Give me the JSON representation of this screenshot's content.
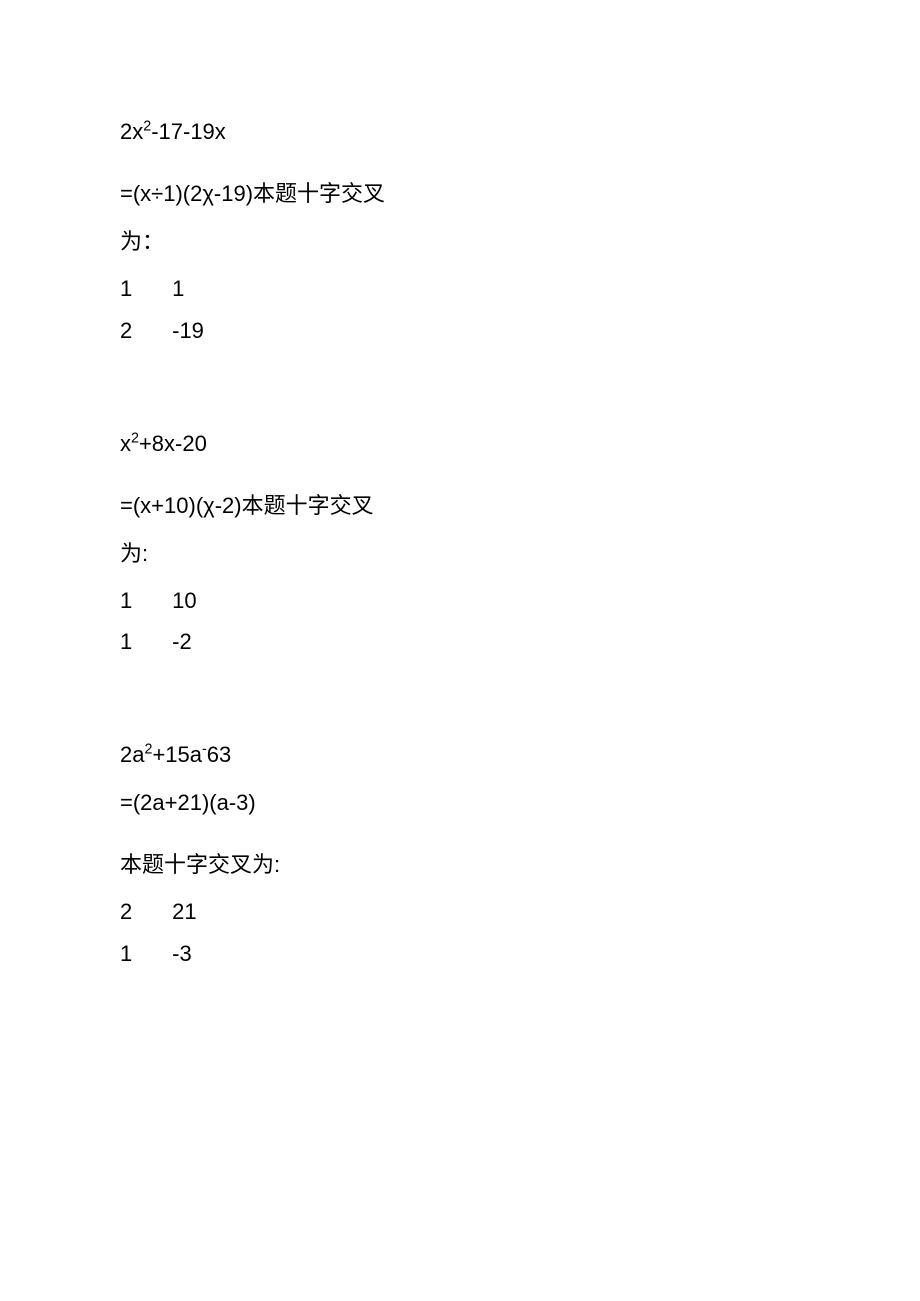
{
  "problems": [
    {
      "expr_pre": "2x",
      "expr_sup": "2",
      "expr_post": "-17-19x",
      "result": "=(x÷1)(2χ-19)本题十字交叉",
      "result_tail": "为：",
      "grid": [
        {
          "a": "1",
          "b": "1"
        },
        {
          "a": "2",
          "b": "-19"
        }
      ]
    },
    {
      "expr_pre": "x",
      "expr_sup": "2",
      "expr_post": "+8x-20",
      "result": "=(x+10)(χ-2)本题十字交叉",
      "result_tail": "为:",
      "grid": [
        {
          "a": "1",
          "b": "10"
        },
        {
          "a": "1",
          "b": "-2"
        }
      ]
    },
    {
      "expr_pre": "2a",
      "expr_sup": "2",
      "expr_mid": "+15a",
      "expr_sup2": "-",
      "expr_post": "63",
      "result": "=(2a+21)(a-3)",
      "result_tail": "本题十字交叉为:",
      "grid": [
        {
          "a": "2",
          "b": "21"
        },
        {
          "a": "1",
          "b": "-3"
        }
      ]
    }
  ]
}
